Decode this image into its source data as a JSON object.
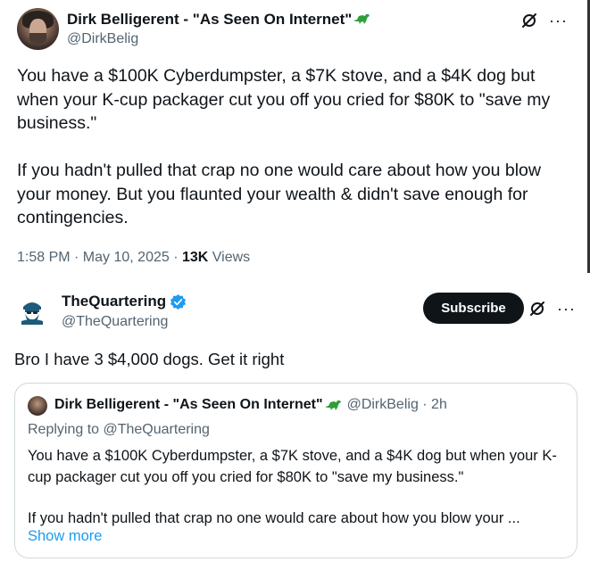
{
  "tweet1": {
    "display_name": "Dirk Belligerent - \"As Seen On Internet\"",
    "handle": "@DirkBelig",
    "paragraph1": "You have a $100K Cyberdumpster, a $7K stove, and a $4K dog but when your K-cup packager cut you off you cried for $80K to \"save my business.\"",
    "paragraph2": "If you hadn't pulled that crap no one would care about how you blow your money. But you flaunted your wealth & didn't save enough for contingencies.",
    "timestamp": "1:58 PM · May 10, 2025 · ",
    "views_count": "13K",
    "views_label": " Views"
  },
  "tweet2": {
    "display_name": "TheQuartering",
    "handle": "@TheQuartering",
    "subscribe_label": "Subscribe",
    "text": "Bro I have 3 $4,000 dogs. Get it right",
    "quote": {
      "display_name": "Dirk Belligerent - \"As Seen On Internet\"",
      "handle_time": "@DirkBelig · 2h",
      "replying_to": "Replying to @TheQuartering",
      "paragraph1": "You have a $100K Cyberdumpster, a $7K stove, and a $4K dog but when your K-cup packager cut you off you cried for $80K to \"save my business.\"",
      "paragraph2": "If you hadn't pulled that crap no one would care about how you blow your ...",
      "show_more": "Show more"
    }
  },
  "icons": {
    "more": "more-icon",
    "grok": "grok-icon",
    "verified": "verified-badge-icon",
    "dino": "dinosaur-emoji-icon"
  },
  "colors": {
    "text": "#0f1419",
    "secondary": "#536471",
    "link": "#1d9bf0",
    "verified": "#1d9bf0",
    "subscribe_bg": "#0f1419",
    "dino": "#2e9e3a"
  }
}
